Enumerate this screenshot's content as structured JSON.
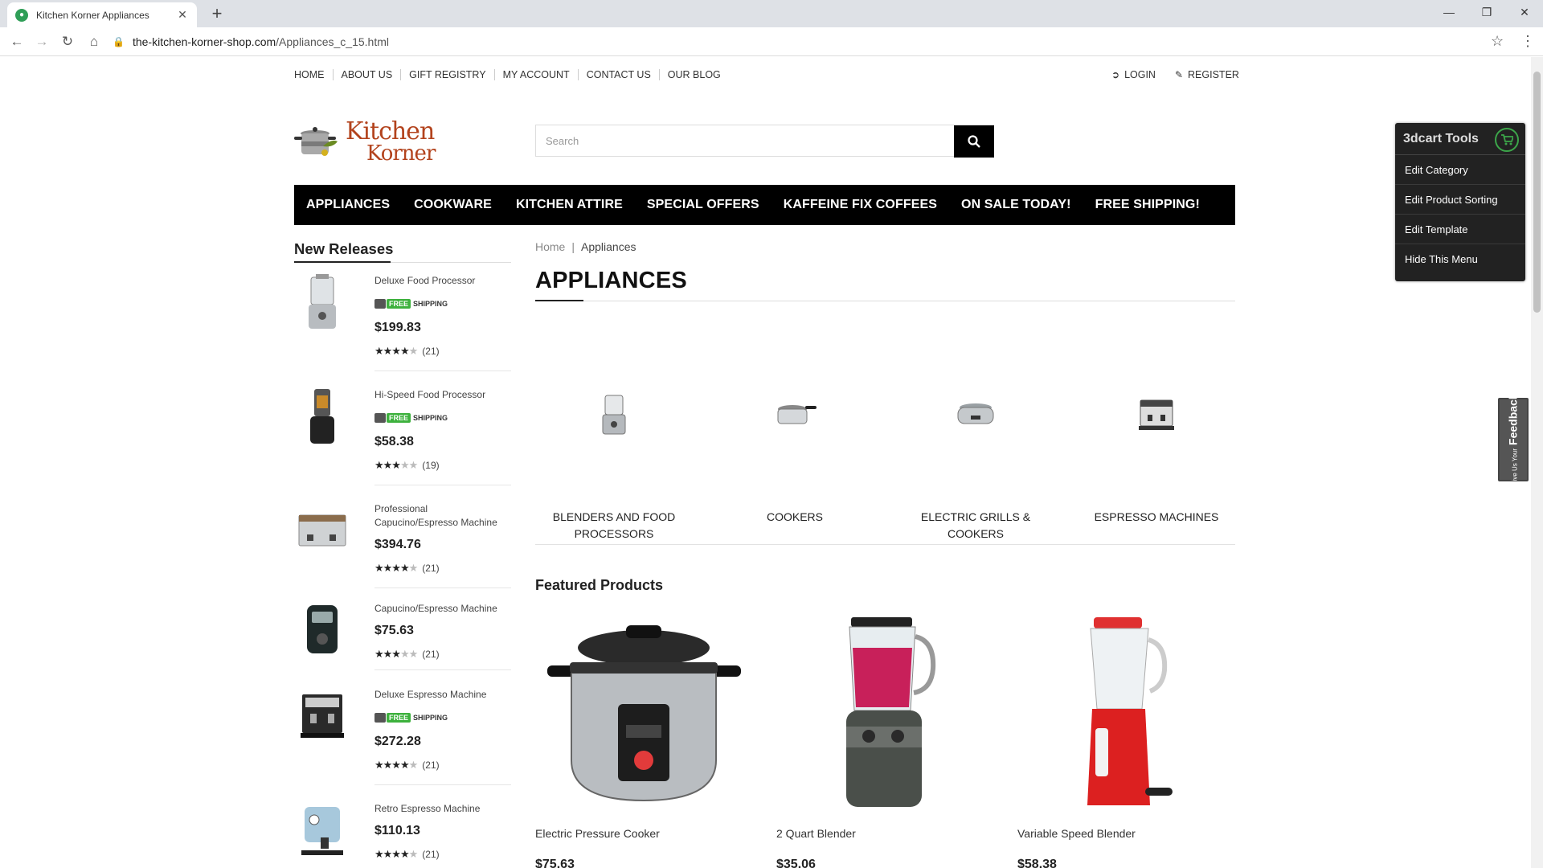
{
  "browser": {
    "tab_title": "Kitchen Korner Appliances",
    "url_domain": "the-kitchen-korner-shop.com",
    "url_path": "/Appliances_c_15.html"
  },
  "topnav": [
    "HOME",
    "ABOUT US",
    "GIFT REGISTRY",
    "MY ACCOUNT",
    "CONTACT US",
    "OUR BLOG"
  ],
  "account": {
    "login": "LOGIN",
    "register": "REGISTER"
  },
  "logo": {
    "line1": "Kitchen",
    "line2": "Korner"
  },
  "search": {
    "placeholder": "Search"
  },
  "mainnav": [
    "APPLIANCES",
    "COOKWARE",
    "KITCHEN ATTIRE",
    "SPECIAL OFFERS",
    "KAFFEINE FIX COFFEES",
    "ON SALE TODAY!",
    "FREE SHIPPING!"
  ],
  "sidebar": {
    "title": "New Releases",
    "free_label": "FREE",
    "shipping_label": "SHIPPING",
    "items": [
      {
        "name": "Deluxe Food Processor",
        "free_shipping": true,
        "price": "$199.83",
        "stars": 4,
        "reviews": "(21)"
      },
      {
        "name": "Hi-Speed Food Processor",
        "free_shipping": true,
        "price": "$58.38",
        "stars": 3,
        "reviews": "(19)"
      },
      {
        "name": "Professional Capucino/Espresso Machine",
        "free_shipping": false,
        "price": "$394.76",
        "stars": 4,
        "reviews": "(21)"
      },
      {
        "name": "Capucino/Espresso Machine",
        "free_shipping": false,
        "price": "$75.63",
        "stars": 3,
        "reviews": "(21)"
      },
      {
        "name": "Deluxe Espresso Machine",
        "free_shipping": true,
        "price": "$272.28",
        "stars": 4,
        "reviews": "(21)"
      },
      {
        "name": "Retro Espresso Machine",
        "free_shipping": false,
        "price": "$110.13",
        "stars": 4,
        "reviews": "(21)"
      }
    ]
  },
  "breadcrumb": {
    "home": "Home",
    "separator": "|",
    "current": "Appliances"
  },
  "page_title": "APPLIANCES",
  "categories": [
    {
      "label": "BLENDERS AND FOOD PROCESSORS",
      "icon": "food-processor-icon"
    },
    {
      "label": "COOKERS",
      "icon": "pressure-cooker-icon"
    },
    {
      "label": "ELECTRIC GRILLS & COOKERS",
      "icon": "slow-cooker-icon"
    },
    {
      "label": "ESPRESSO MACHINES",
      "icon": "espresso-machine-icon"
    }
  ],
  "featured": {
    "title": "Featured Products",
    "products": [
      {
        "name": "Electric Pressure Cooker",
        "price": "$75.63"
      },
      {
        "name": "2 Quart Blender",
        "price": "$35.06"
      },
      {
        "name": "Variable Speed Blender",
        "price": "$58.38"
      }
    ]
  },
  "tools": {
    "title": "3dcart Tools",
    "items": [
      "Edit Category",
      "Edit Product Sorting",
      "Edit Template",
      "Hide This Menu"
    ]
  },
  "feedback": {
    "small": "Give Us Your",
    "big": "Feedback"
  }
}
